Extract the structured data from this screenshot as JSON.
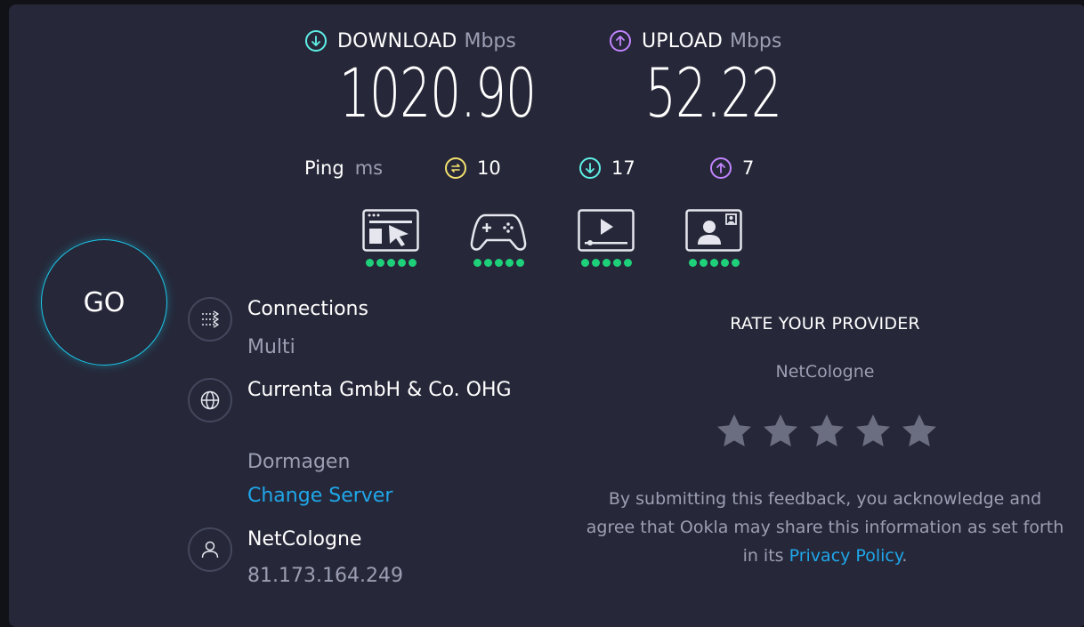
{
  "download": {
    "label": "DOWNLOAD",
    "unit": "Mbps",
    "value": "1020.90",
    "icon": "arrow-down-icon",
    "color": "#5ff0e6"
  },
  "upload": {
    "label": "UPLOAD",
    "unit": "Mbps",
    "value": "52.22",
    "icon": "arrow-up-icon",
    "color": "#c384ff"
  },
  "ping": {
    "label": "Ping",
    "unit": "ms",
    "idle": {
      "value": "10",
      "icon": "ping-idle-icon",
      "color": "#f3e16f"
    },
    "download": {
      "value": "17",
      "icon": "arrow-down-icon",
      "color": "#5ff0e6"
    },
    "upload": {
      "value": "7",
      "icon": "arrow-up-icon",
      "color": "#c384ff"
    }
  },
  "performance": [
    {
      "icon": "web-browsing-icon",
      "rating": 5
    },
    {
      "icon": "gaming-icon",
      "rating": 5
    },
    {
      "icon": "video-streaming-icon",
      "rating": 5
    },
    {
      "icon": "video-chat-icon",
      "rating": 5
    }
  ],
  "go_label": "GO",
  "connections": {
    "title": "Connections",
    "value": "Multi",
    "icon": "connections-icon"
  },
  "server": {
    "name": "Currenta GmbH & Co. OHG",
    "location": "Dormagen",
    "change_label": "Change Server",
    "icon": "globe-icon"
  },
  "provider": {
    "name": "NetCologne",
    "ip": "81.173.164.249",
    "icon": "user-icon"
  },
  "rating": {
    "title": "RATE YOUR PROVIDER",
    "provider": "NetCologne",
    "stars": 5,
    "disclaimer_pre": "By submitting this feedback, you acknowledge and agree that Ookla may share this information as set forth in its ",
    "privacy_link": "Privacy Policy",
    "disclaimer_post": "."
  },
  "colors": {
    "accent": "#1bc9ea",
    "link": "#1fa7ea",
    "good": "#1fd07a",
    "background": "#262839"
  }
}
